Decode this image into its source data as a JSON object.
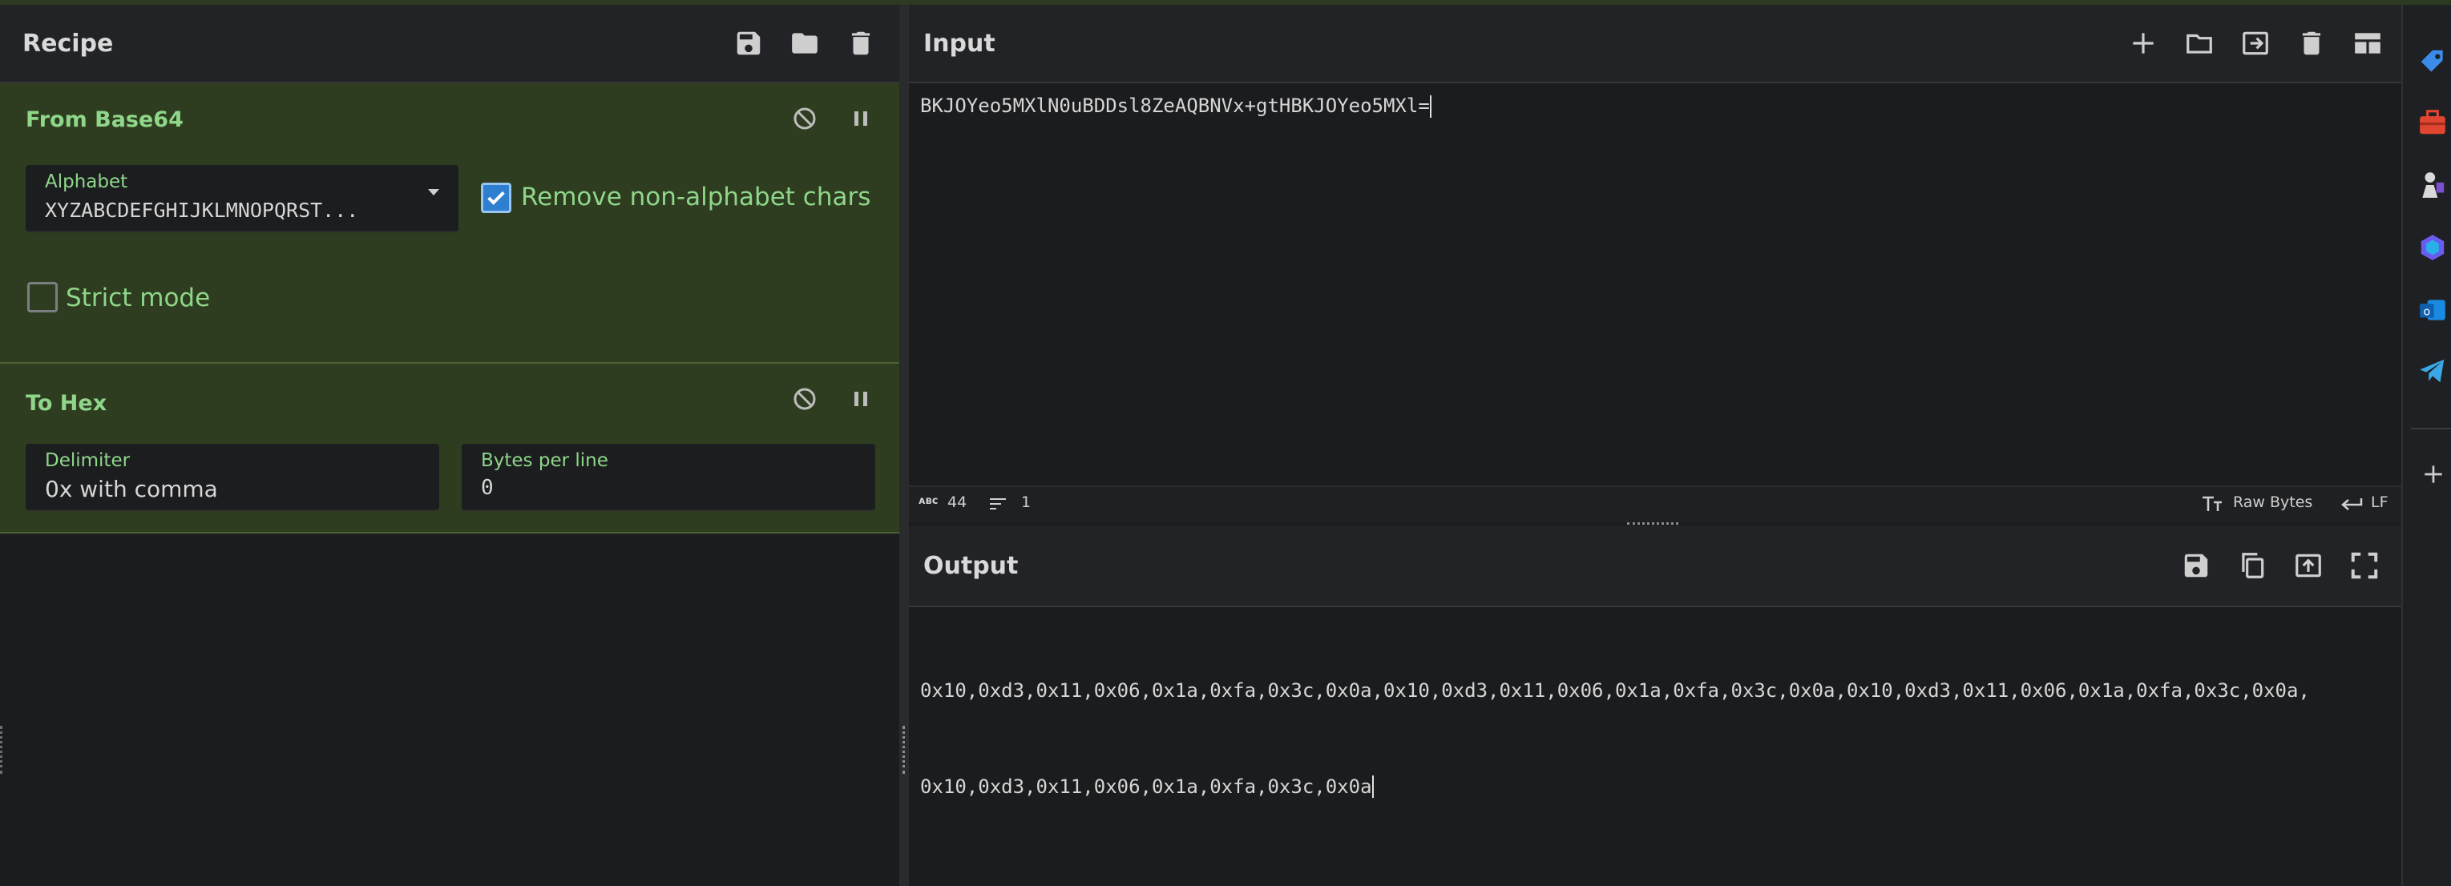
{
  "recipe": {
    "title": "Recipe",
    "operations": [
      {
        "name": "From Base64",
        "alphabet_label": "Alphabet",
        "alphabet_value": "XYZABCDEFGHIJKLMNOPQRST...",
        "remove_non_alphabet_label": "Remove non-alphabet chars",
        "remove_non_alphabet_checked": true,
        "strict_mode_label": "Strict mode",
        "strict_mode_checked": false
      },
      {
        "name": "To Hex",
        "delimiter_label": "Delimiter",
        "delimiter_value": "0x with comma",
        "bytes_per_line_label": "Bytes per line",
        "bytes_per_line_value": "0"
      }
    ]
  },
  "input": {
    "title": "Input",
    "text": "BKJOYeo5MXlN0uBDDsl8ZeAQBNVx+gtHBKJOYeo5MXl=",
    "status": {
      "abc_label": "ᴀʙᴄ",
      "char_count": "44",
      "line_count": "1",
      "encoding_label": "Raw Bytes",
      "eol_label": "LF"
    }
  },
  "output": {
    "title": "Output",
    "lines": [
      "0x10,0xd3,0x11,0x06,0x1a,0xfa,0x3c,0x0a,0x10,0xd3,0x11,0x06,0x1a,0xfa,0x3c,0x0a,0x10,0xd3,0x11,0x06,0x1a,0xfa,0x3c,0x0a,",
      "0x10,0xd3,0x11,0x06,0x1a,0xfa,0x3c,0x0a"
    ]
  },
  "theme": {
    "accent_green": "#8fd68a",
    "op_background": "#2e3d1f",
    "checkbox_blue": "#2f7fd0"
  },
  "sidebar": {
    "icons": [
      "tag-icon",
      "toolbox-icon",
      "chess-icon",
      "copilot-icon",
      "outlook-icon",
      "telegram-icon",
      "plus-icon"
    ]
  }
}
